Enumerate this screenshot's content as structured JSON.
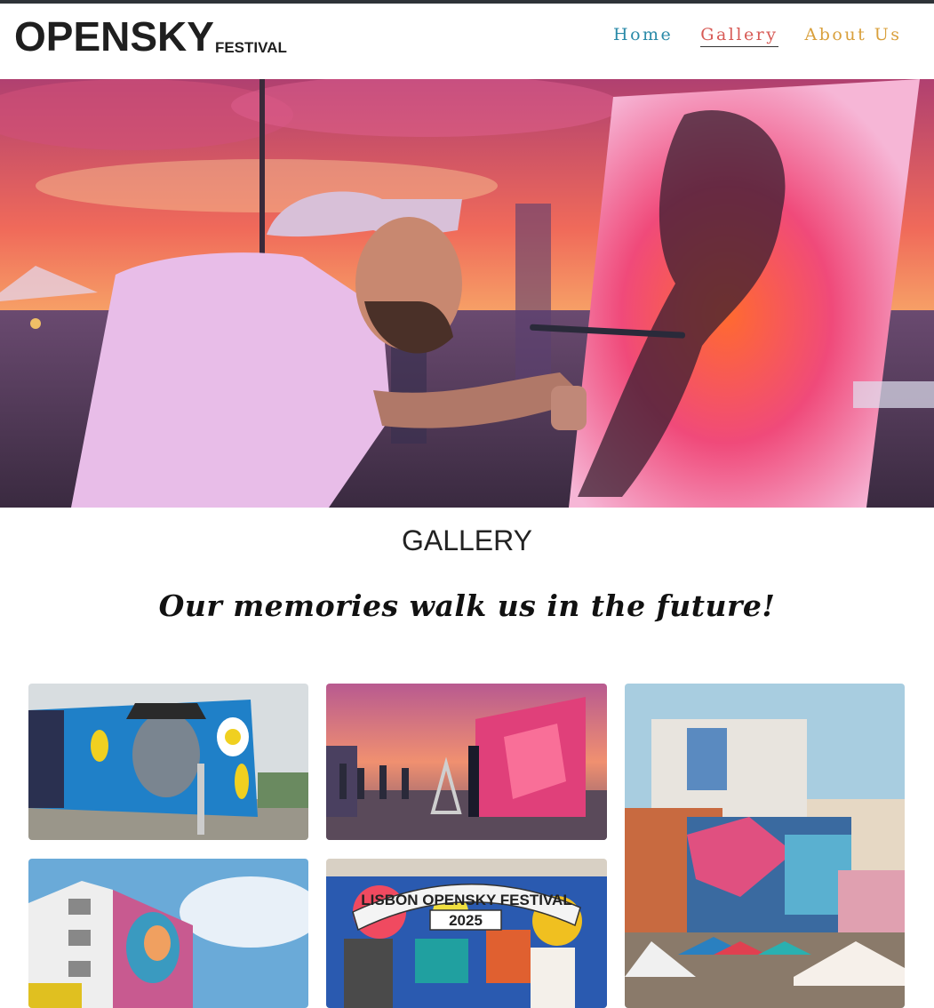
{
  "header": {
    "brand_main": "OPENSKY",
    "brand_sub": "FESTIVAL"
  },
  "nav": {
    "items": [
      {
        "label": "Home",
        "active": false,
        "color": "#2a8aa8"
      },
      {
        "label": "Gallery",
        "active": true,
        "color": "#d75a55"
      },
      {
        "label": "About Us",
        "active": false,
        "color": "#d9a03c"
      }
    ]
  },
  "hero": {
    "image": "artist painting on canvas at sunset festival"
  },
  "gallery": {
    "title": "GALLERY",
    "tagline": "Our memories walk us in the future!",
    "images": [
      {
        "name": "mural-man-with-hat"
      },
      {
        "name": "sunset-live-painting"
      },
      {
        "name": "colorful-building-murals"
      },
      {
        "name": "white-building-mural"
      },
      {
        "name": "festival-mural",
        "banner_text": "LISBON OPENSKY FESTIVAL",
        "banner_year": "2025"
      }
    ]
  },
  "colors": {
    "topbar": "#2e3338",
    "text": "#222222"
  }
}
